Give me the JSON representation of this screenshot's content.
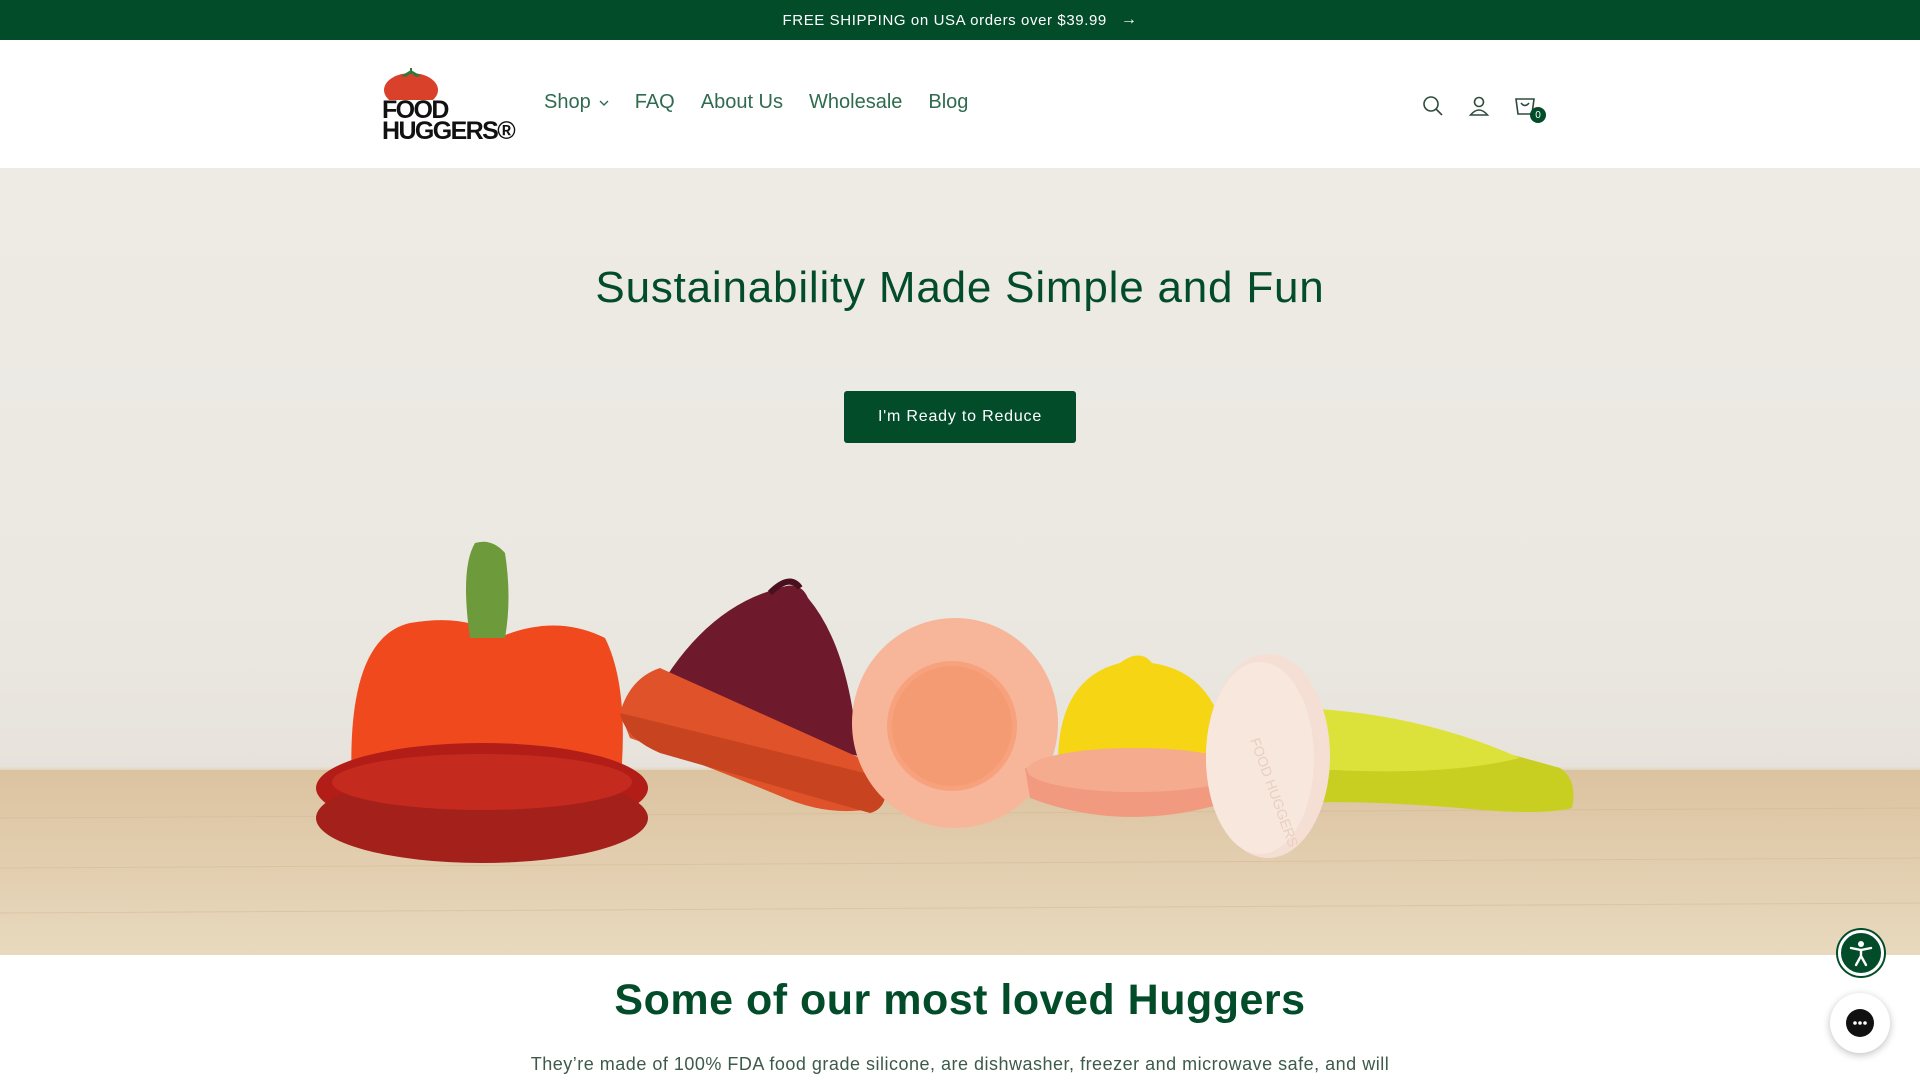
{
  "announcement": {
    "text": "FREE SHIPPING on USA orders over $39.99",
    "arrow_icon": "arrow-right-icon"
  },
  "logo": {
    "line1": "FOOD",
    "line2": "HUGGERS®",
    "icon": "tomato-icon"
  },
  "nav": {
    "items": [
      {
        "label": "Shop",
        "has_dropdown": true
      },
      {
        "label": "FAQ"
      },
      {
        "label": "About Us"
      },
      {
        "label": "Wholesale"
      },
      {
        "label": "Blog"
      }
    ]
  },
  "header_icons": {
    "search": "search-icon",
    "account": "account-icon",
    "cart": "cart-icon",
    "cart_count": "0"
  },
  "hero": {
    "title": "Sustainability Made Simple and Fun",
    "button_label": "I'm Ready to Reduce",
    "hugger_embossed_text": "FOOD HUGGERS"
  },
  "loved": {
    "title": "Some of our most loved Huggers",
    "text": "They’re made of 100% FDA food grade silicone, are dishwasher, freezer and microwave safe, and will"
  },
  "floating": {
    "accessibility": "accessibility-icon",
    "chat": "chat-icon"
  },
  "colors": {
    "brand_green": "#034c2a",
    "nav_text": "#2f6b4f",
    "hero_bg": "#eeebe5"
  }
}
